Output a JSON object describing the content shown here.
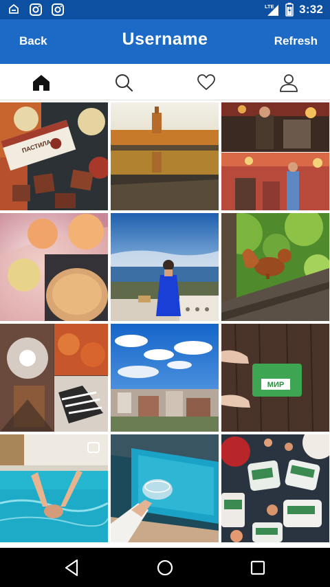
{
  "status_bar": {
    "time": "3:32",
    "network": "LTE",
    "icons": [
      "notification-icon",
      "instagram-icon",
      "instagram-icon",
      "signal-icon",
      "battery-icon"
    ]
  },
  "header": {
    "back_label": "Back",
    "title": "Username",
    "refresh_label": "Refresh"
  },
  "tabs": [
    {
      "icon": "home-icon",
      "active": true
    },
    {
      "icon": "search-icon",
      "active": false
    },
    {
      "icon": "heart-icon",
      "active": false
    },
    {
      "icon": "profile-icon",
      "active": false
    }
  ],
  "grid": {
    "photos": [
      {
        "subject": "chocolate-bar-and-apples",
        "caption": "ПАСТИЛА"
      },
      {
        "subject": "lake-reflection-with-building",
        "caption": ""
      },
      {
        "subject": "concert-collage",
        "caption": ""
      },
      {
        "subject": "apples-and-pie",
        "caption": ""
      },
      {
        "subject": "woman-in-blue-dress-overlooking-city",
        "caption": ""
      },
      {
        "subject": "squirrel-on-tree",
        "caption": ""
      },
      {
        "subject": "autumn-trees-collage",
        "caption": ""
      },
      {
        "subject": "city-skyline-blue-sky",
        "caption": ""
      },
      {
        "subject": "hand-holding-green-card",
        "caption": "МИР"
      },
      {
        "subject": "swimmer-in-pool",
        "caption": ""
      },
      {
        "subject": "glass-by-pool",
        "caption": ""
      },
      {
        "subject": "food-containers-flatlay",
        "caption": ""
      }
    ]
  },
  "colors": {
    "status_bar": "#0d4fa0",
    "app_bar": "#1c6ac6",
    "nav_bar": "#000000"
  },
  "nav": [
    "back-nav-icon",
    "home-nav-icon",
    "recents-nav-icon"
  ]
}
